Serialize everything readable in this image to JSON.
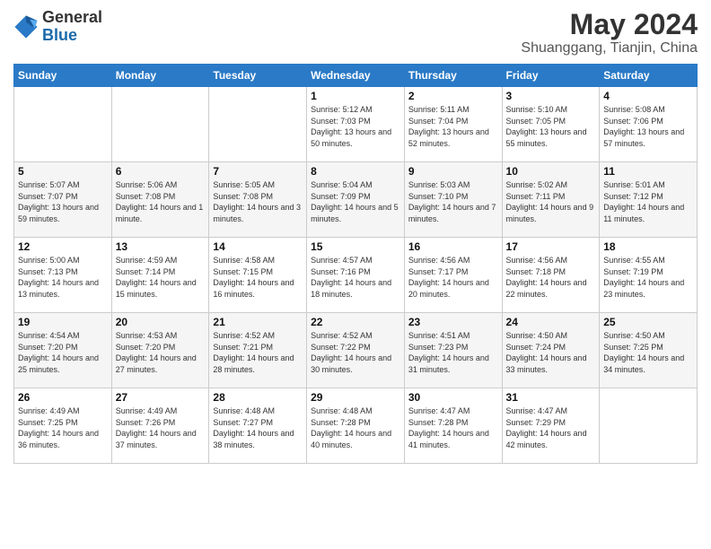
{
  "header": {
    "logo_general": "General",
    "logo_blue": "Blue",
    "month_year": "May 2024",
    "location": "Shuanggang, Tianjin, China"
  },
  "weekdays": [
    "Sunday",
    "Monday",
    "Tuesday",
    "Wednesday",
    "Thursday",
    "Friday",
    "Saturday"
  ],
  "weeks": [
    [
      {
        "day": "",
        "info": ""
      },
      {
        "day": "",
        "info": ""
      },
      {
        "day": "",
        "info": ""
      },
      {
        "day": "1",
        "info": "Sunrise: 5:12 AM\nSunset: 7:03 PM\nDaylight: 13 hours and 50 minutes."
      },
      {
        "day": "2",
        "info": "Sunrise: 5:11 AM\nSunset: 7:04 PM\nDaylight: 13 hours and 52 minutes."
      },
      {
        "day": "3",
        "info": "Sunrise: 5:10 AM\nSunset: 7:05 PM\nDaylight: 13 hours and 55 minutes."
      },
      {
        "day": "4",
        "info": "Sunrise: 5:08 AM\nSunset: 7:06 PM\nDaylight: 13 hours and 57 minutes."
      }
    ],
    [
      {
        "day": "5",
        "info": "Sunrise: 5:07 AM\nSunset: 7:07 PM\nDaylight: 13 hours and 59 minutes."
      },
      {
        "day": "6",
        "info": "Sunrise: 5:06 AM\nSunset: 7:08 PM\nDaylight: 14 hours and 1 minute."
      },
      {
        "day": "7",
        "info": "Sunrise: 5:05 AM\nSunset: 7:08 PM\nDaylight: 14 hours and 3 minutes."
      },
      {
        "day": "8",
        "info": "Sunrise: 5:04 AM\nSunset: 7:09 PM\nDaylight: 14 hours and 5 minutes."
      },
      {
        "day": "9",
        "info": "Sunrise: 5:03 AM\nSunset: 7:10 PM\nDaylight: 14 hours and 7 minutes."
      },
      {
        "day": "10",
        "info": "Sunrise: 5:02 AM\nSunset: 7:11 PM\nDaylight: 14 hours and 9 minutes."
      },
      {
        "day": "11",
        "info": "Sunrise: 5:01 AM\nSunset: 7:12 PM\nDaylight: 14 hours and 11 minutes."
      }
    ],
    [
      {
        "day": "12",
        "info": "Sunrise: 5:00 AM\nSunset: 7:13 PM\nDaylight: 14 hours and 13 minutes."
      },
      {
        "day": "13",
        "info": "Sunrise: 4:59 AM\nSunset: 7:14 PM\nDaylight: 14 hours and 15 minutes."
      },
      {
        "day": "14",
        "info": "Sunrise: 4:58 AM\nSunset: 7:15 PM\nDaylight: 14 hours and 16 minutes."
      },
      {
        "day": "15",
        "info": "Sunrise: 4:57 AM\nSunset: 7:16 PM\nDaylight: 14 hours and 18 minutes."
      },
      {
        "day": "16",
        "info": "Sunrise: 4:56 AM\nSunset: 7:17 PM\nDaylight: 14 hours and 20 minutes."
      },
      {
        "day": "17",
        "info": "Sunrise: 4:56 AM\nSunset: 7:18 PM\nDaylight: 14 hours and 22 minutes."
      },
      {
        "day": "18",
        "info": "Sunrise: 4:55 AM\nSunset: 7:19 PM\nDaylight: 14 hours and 23 minutes."
      }
    ],
    [
      {
        "day": "19",
        "info": "Sunrise: 4:54 AM\nSunset: 7:20 PM\nDaylight: 14 hours and 25 minutes."
      },
      {
        "day": "20",
        "info": "Sunrise: 4:53 AM\nSunset: 7:20 PM\nDaylight: 14 hours and 27 minutes."
      },
      {
        "day": "21",
        "info": "Sunrise: 4:52 AM\nSunset: 7:21 PM\nDaylight: 14 hours and 28 minutes."
      },
      {
        "day": "22",
        "info": "Sunrise: 4:52 AM\nSunset: 7:22 PM\nDaylight: 14 hours and 30 minutes."
      },
      {
        "day": "23",
        "info": "Sunrise: 4:51 AM\nSunset: 7:23 PM\nDaylight: 14 hours and 31 minutes."
      },
      {
        "day": "24",
        "info": "Sunrise: 4:50 AM\nSunset: 7:24 PM\nDaylight: 14 hours and 33 minutes."
      },
      {
        "day": "25",
        "info": "Sunrise: 4:50 AM\nSunset: 7:25 PM\nDaylight: 14 hours and 34 minutes."
      }
    ],
    [
      {
        "day": "26",
        "info": "Sunrise: 4:49 AM\nSunset: 7:25 PM\nDaylight: 14 hours and 36 minutes."
      },
      {
        "day": "27",
        "info": "Sunrise: 4:49 AM\nSunset: 7:26 PM\nDaylight: 14 hours and 37 minutes."
      },
      {
        "day": "28",
        "info": "Sunrise: 4:48 AM\nSunset: 7:27 PM\nDaylight: 14 hours and 38 minutes."
      },
      {
        "day": "29",
        "info": "Sunrise: 4:48 AM\nSunset: 7:28 PM\nDaylight: 14 hours and 40 minutes."
      },
      {
        "day": "30",
        "info": "Sunrise: 4:47 AM\nSunset: 7:28 PM\nDaylight: 14 hours and 41 minutes."
      },
      {
        "day": "31",
        "info": "Sunrise: 4:47 AM\nSunset: 7:29 PM\nDaylight: 14 hours and 42 minutes."
      },
      {
        "day": "",
        "info": ""
      }
    ]
  ]
}
